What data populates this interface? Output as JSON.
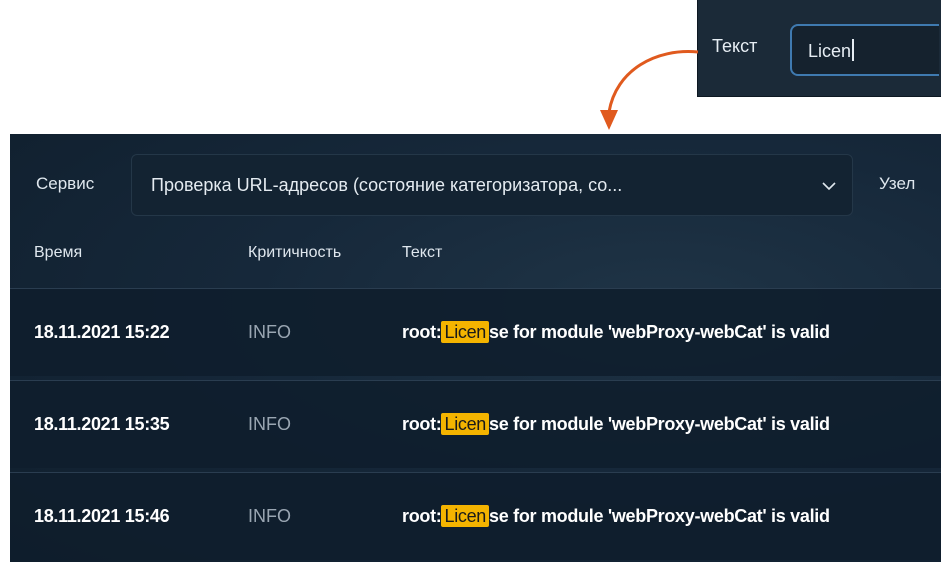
{
  "search": {
    "label": "Текст",
    "value": "Licen"
  },
  "filters": {
    "service_label": "Сервис",
    "service_value": "Проверка URL-адресов (состояние категоризатора, со...",
    "node_label": "Узел"
  },
  "table": {
    "headers": {
      "time": "Время",
      "severity": "Критичность",
      "text": "Текст"
    },
    "rows": [
      {
        "time": "18.11.2021 15:22",
        "severity": "INFO",
        "text_prefix": "root:",
        "highlight": "Licen",
        "text_suffix": "se for module 'webProxy-webCat' is valid"
      },
      {
        "time": "18.11.2021 15:35",
        "severity": "INFO",
        "text_prefix": "root:",
        "highlight": "Licen",
        "text_suffix": "se for module 'webProxy-webCat' is valid"
      },
      {
        "time": "18.11.2021 15:46",
        "severity": "INFO",
        "text_prefix": "root:",
        "highlight": "Licen",
        "text_suffix": "se for module 'webProxy-webCat' is valid"
      }
    ]
  },
  "colors": {
    "accent": "#3f7ab0",
    "highlight": "#f4b400",
    "arrow": "#e05a1e"
  },
  "icons": {
    "select_chevron": "chevron-down-icon",
    "callout_arrow": "curved-arrow-icon"
  }
}
